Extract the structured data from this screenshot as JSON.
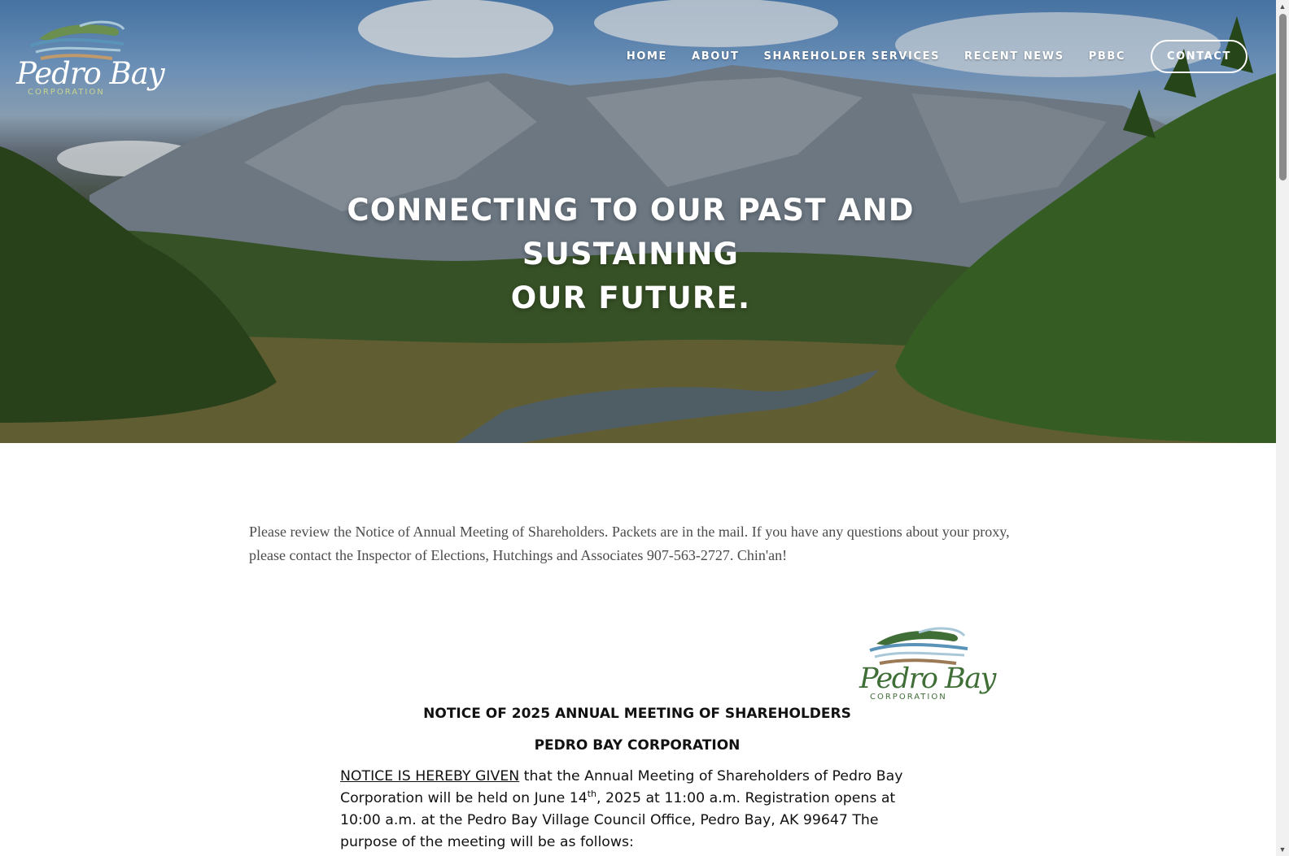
{
  "brand": {
    "logo_name": "Pedro Bay",
    "logo_subtitle": "CORPORATION"
  },
  "nav": {
    "items": [
      "HOME",
      "ABOUT",
      "SHAREHOLDER SERVICES",
      "RECENT NEWS",
      "PBBC"
    ],
    "contact_label": "CONTACT"
  },
  "hero": {
    "title_line1": "CONNECTING TO OUR PAST AND SUSTAINING",
    "title_line2": "OUR FUTURE."
  },
  "content": {
    "intro": "Please review the Notice of Annual Meeting of Shareholders. Packets are in the mail. If you have any questions about your proxy, please contact the Inspector of Elections, Hutchings and Associates 907-563-2727. Chin'an!"
  },
  "notice": {
    "logo_name": "Pedro Bay",
    "logo_subtitle": "CORPORATION",
    "heading_1": "NOTICE OF 2025 ANNUAL MEETING OF SHAREHOLDERS",
    "heading_2": "PEDRO BAY CORPORATION",
    "lead": "NOTICE IS HEREBY GIVEN",
    "body_part1": " that the Annual Meeting of Shareholders of Pedro Bay Corporation will be held on June 14",
    "body_sup": "th",
    "body_part2": ", 2025 at 11:00 a.m. Registration opens at 10:00 a.m. at the Pedro Bay Village Council Office, Pedro Bay, AK 99647 The purpose of the meeting will be as follows:"
  },
  "colors": {
    "logo_blue": "#5a93b8",
    "logo_brown": "#9b7a55",
    "logo_green": "#3f6e37",
    "logo_light_blue": "#a8c8da",
    "text_dark": "#111111",
    "intro_text": "#4b4b4b"
  }
}
